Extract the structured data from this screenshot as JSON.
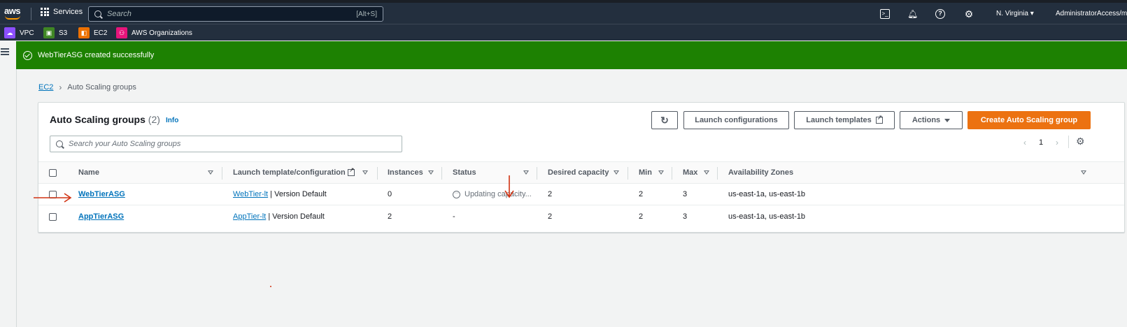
{
  "topnav": {
    "logo": "aws",
    "services_label": "Services",
    "search_placeholder": "Search",
    "search_shortcut": "[Alt+S]",
    "region": "N. Virginia ▾",
    "account": "AdministratorAccess/m"
  },
  "favorites": [
    {
      "label": "VPC",
      "icon": "vpc-icon",
      "color": "#8c4fff"
    },
    {
      "label": "S3",
      "icon": "s3-icon",
      "color": "#3f8624"
    },
    {
      "label": "EC2",
      "icon": "ec2-icon",
      "color": "#ed7100"
    },
    {
      "label": "AWS Organizations",
      "icon": "organizations-icon",
      "color": "#e7157b"
    }
  ],
  "flash": {
    "message": "WebTierASG created successfully",
    "color": "#1d8102"
  },
  "breadcrumb": {
    "parent": "EC2",
    "current": "Auto Scaling groups"
  },
  "panel": {
    "title": "Auto Scaling groups",
    "count": "(2)",
    "info": "Info",
    "buttons": {
      "launch_configurations": "Launch configurations",
      "launch_templates": "Launch templates",
      "actions": "Actions",
      "create": "Create Auto Scaling group"
    },
    "search_placeholder": "Search your Auto Scaling groups",
    "page": "1"
  },
  "table": {
    "columns": [
      "Name",
      "Launch template/configuration",
      "Instances",
      "Status",
      "Desired capacity",
      "Min",
      "Max",
      "Availability Zones"
    ],
    "rows": [
      {
        "name": "WebTierASG",
        "lt_name": "WebTier-lt",
        "lt_version": " | Version Default",
        "instances": "0",
        "status": "Updating capacity...",
        "desired": "2",
        "min": "2",
        "max": "3",
        "azs": "us-east-1a, us-east-1b"
      },
      {
        "name": "AppTierASG",
        "lt_name": "AppTier-lt",
        "lt_version": " | Version Default",
        "instances": "2",
        "status": "-",
        "desired": "2",
        "min": "2",
        "max": "3",
        "azs": "us-east-1a, us-east-1b"
      }
    ]
  },
  "colors": {
    "primary_button": "#ec7211",
    "link": "#0073bb",
    "annotation_arrow": "#d13212"
  }
}
